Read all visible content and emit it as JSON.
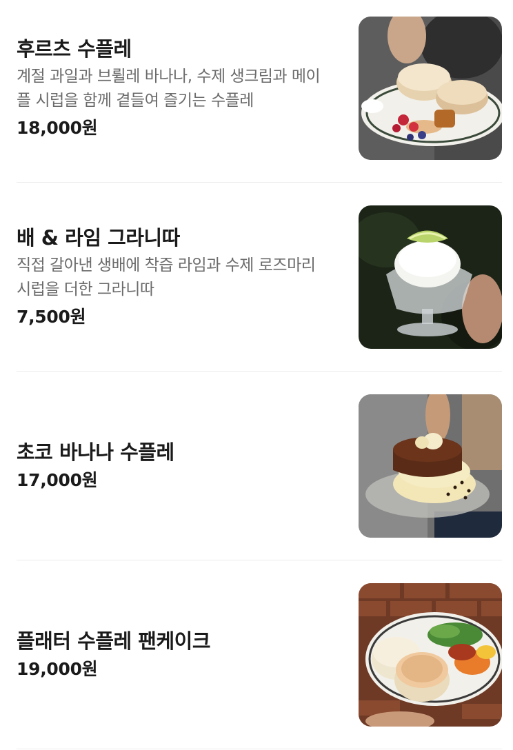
{
  "menu": {
    "items": [
      {
        "title": "후르츠 수플레",
        "description": "계절 과일과 브륄레 바나나, 수제 생크림과 메이플 시럽을 함께 곁들여 즐기는 수플레",
        "price": "18,000원",
        "photo_subject": "fruit-souffle-pancake-photo"
      },
      {
        "title": "배 & 라임 그라니따",
        "description": "직접 갈아낸 생배에 착즙 라임과 수제 로즈마리 시럽을 더한 그라니따",
        "price": "7,500원",
        "photo_subject": "pear-lime-granita-photo"
      },
      {
        "title": "초코 바나나 수플레",
        "description": "",
        "price": "17,000원",
        "photo_subject": "choco-banana-souffle-photo"
      },
      {
        "title": "플래터 수플레 팬케이크",
        "description": "",
        "price": "19,000원",
        "photo_subject": "platter-souffle-pancake-photo"
      }
    ]
  },
  "colors": {
    "title": "#1a1a1a",
    "description": "#6b6b6b",
    "divider": "#ececec"
  }
}
